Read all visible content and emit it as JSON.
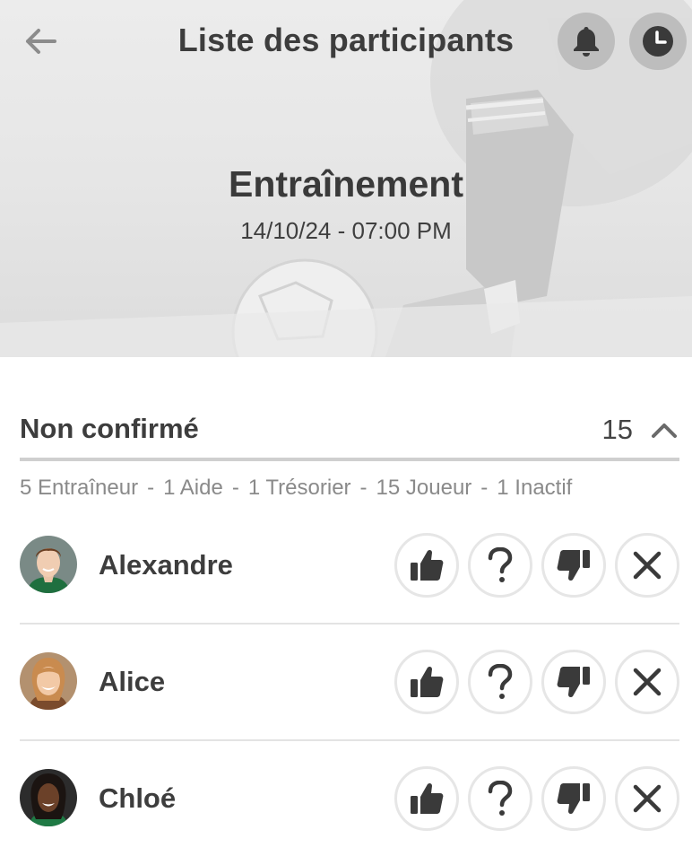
{
  "header": {
    "title": "Liste des participants",
    "back_icon": "arrow-left-icon",
    "bell_icon": "bell-icon",
    "clock_icon": "clock-icon"
  },
  "event": {
    "title": "Entraînement",
    "datetime": "14/10/24 - 07:00 PM"
  },
  "section": {
    "title": "Non confirmé",
    "count": "15",
    "toggle_icon": "chevron-up-icon"
  },
  "roles": [
    "5 Entraîneur",
    "1 Aide",
    "1 Trésorier",
    "15 Joueur",
    "1 Inactif"
  ],
  "roles_separator": "-",
  "participants": [
    {
      "name": "Alexandre"
    },
    {
      "name": "Alice"
    },
    {
      "name": "Chloé"
    }
  ],
  "action_icons": [
    "thumbs-up-icon",
    "question-icon",
    "thumbs-down-icon",
    "close-icon"
  ],
  "colors": {
    "icon_dark": "#3a3a3a",
    "round_button_bg": "#bdbdbd",
    "divider": "#cfcfcf",
    "muted_text": "#8a8a8a"
  }
}
